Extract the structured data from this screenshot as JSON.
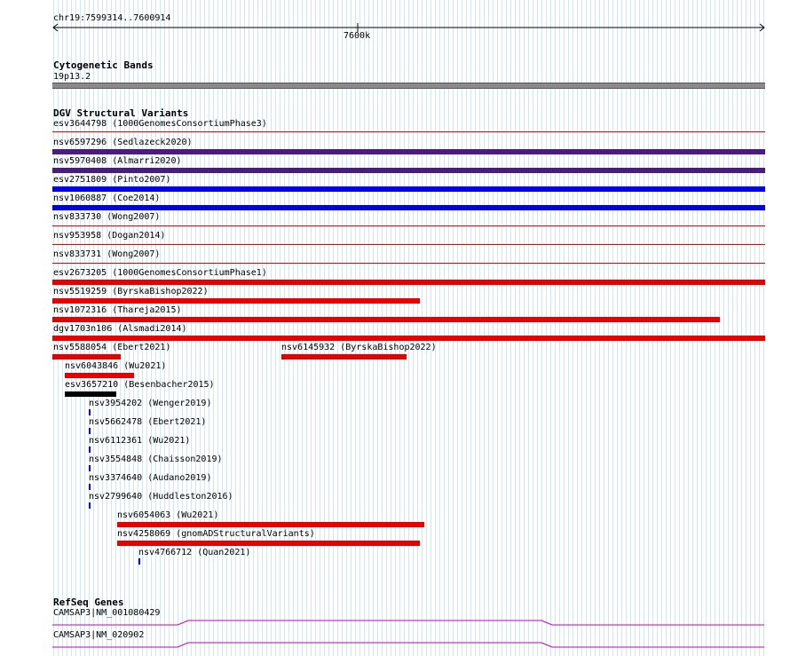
{
  "ruler": {
    "coords": "chr19:7599314..7600914",
    "tick_label": "7600k"
  },
  "cytoband": {
    "title": "Cytogenetic Bands",
    "band": "19p13.2"
  },
  "dgv": {
    "title": "DGV Structural Variants",
    "variants": [
      {
        "label": "esv3644798 (1000GenomesConsortiumPhase3)",
        "color": "#e60000",
        "style": "thin"
      },
      {
        "label": "nsv6597296 (Sedlazeck2020)",
        "color": "#4b1c80",
        "style": "thick"
      },
      {
        "label": "nsv5970408 (Almarri2020)",
        "color": "#4b1c80",
        "style": "thick"
      },
      {
        "label": "esv2751809 (Pinto2007)",
        "color": "#0000e6",
        "style": "thick"
      },
      {
        "label": "nsv1060887 (Coe2014)",
        "color": "#0000e6",
        "style": "thick"
      },
      {
        "label": "nsv833730 (Wong2007)",
        "color": "#e60000",
        "style": "thin"
      },
      {
        "label": "nsv953958 (Dogan2014)",
        "color": "#e60000",
        "style": "thin"
      },
      {
        "label": "nsv833731 (Wong2007)",
        "color": "#e60000",
        "style": "thin"
      },
      {
        "label": "esv2673205 (1000GenomesConsortiumPhase1)",
        "color": "#e60000",
        "style": "thick"
      },
      {
        "label": "nsv5519259 (ByrskaBishop2022)",
        "color": "#e60000",
        "style": "thick"
      },
      {
        "label": "nsv1072316 (Thareja2015)",
        "color": "#e60000",
        "style": "thick"
      },
      {
        "label": "dgv1703n106 (Alsmadi2014)",
        "color": "#e60000",
        "style": "thick"
      },
      {
        "label": "nsv5588054 (Ebert2021)",
        "color": "#e60000",
        "style": "thick"
      },
      {
        "label": "nsv6145932 (ByrskaBishop2022)",
        "color": "#e60000",
        "style": "thick"
      },
      {
        "label": "nsv6043846 (Wu2021)",
        "color": "#e60000",
        "style": "thick"
      },
      {
        "label": "esv3657210 (Besenbacher2015)",
        "color": "#000000",
        "style": "thick"
      },
      {
        "label": "nsv3954202 (Wenger2019)",
        "color": "#0000e6",
        "style": "dash"
      },
      {
        "label": "nsv5662478 (Ebert2021)",
        "color": "#0000e6",
        "style": "dash"
      },
      {
        "label": "nsv6112361 (Wu2021)",
        "color": "#0000e6",
        "style": "dash"
      },
      {
        "label": "nsv3554848 (Chaisson2019)",
        "color": "#0000e6",
        "style": "dash"
      },
      {
        "label": "nsv3374640 (Audano2019)",
        "color": "#0000e6",
        "style": "dash"
      },
      {
        "label": "nsv2799640 (Huddleston2016)",
        "color": "#0000e6",
        "style": "dash"
      },
      {
        "label": "nsv6054063 (Wu2021)",
        "color": "#e60000",
        "style": "thick"
      },
      {
        "label": "nsv4258069 (gnomADStructuralVariants)",
        "color": "#e60000",
        "style": "thick"
      },
      {
        "label": "nsv4766712 (Quan2021)",
        "color": "#0000e6",
        "style": "dash"
      }
    ]
  },
  "refseq": {
    "title": "RefSeq Genes",
    "genes": [
      {
        "label": "CAMSAP3|NM_001080429",
        "color": "#c000c0"
      },
      {
        "label": "CAMSAP3|NM_020902",
        "color": "#c000c0"
      }
    ]
  }
}
